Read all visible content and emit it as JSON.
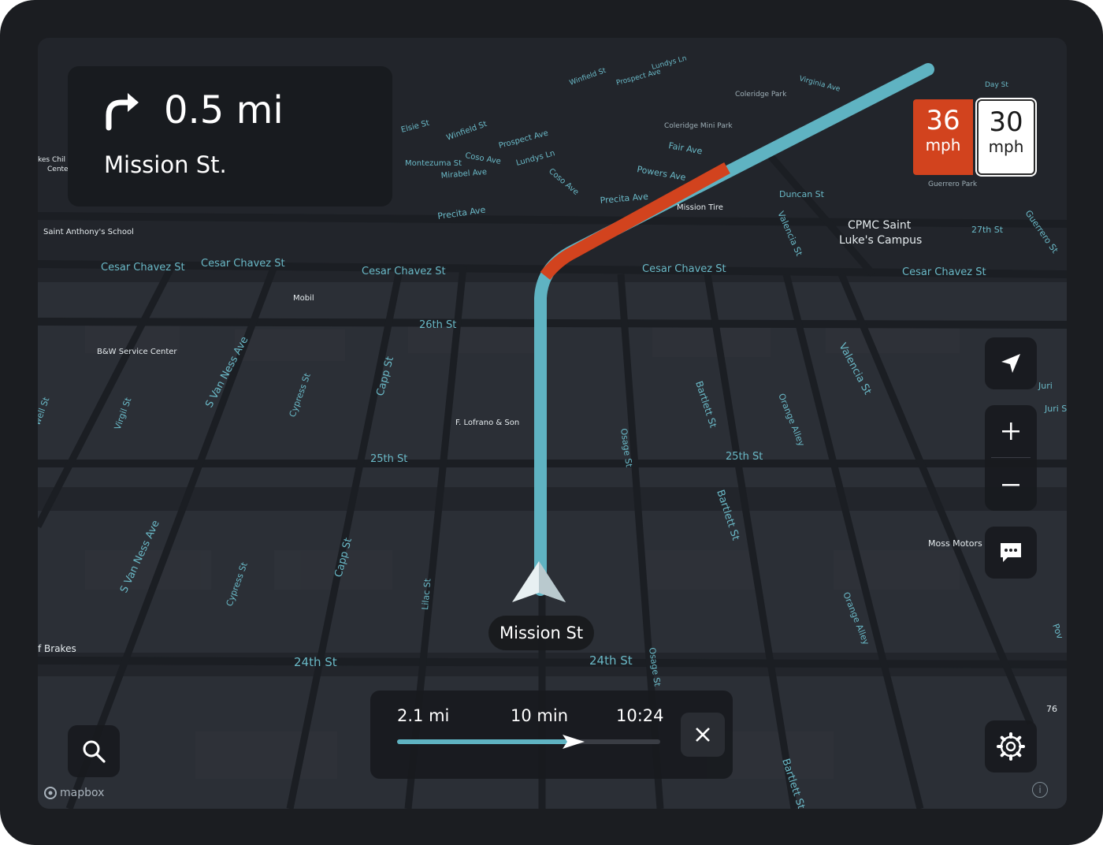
{
  "maneuver": {
    "distance": "0.5 mi",
    "street": "Mission St."
  },
  "speed": {
    "current": "36",
    "current_unit": "mph",
    "limit": "30",
    "limit_unit": "mph"
  },
  "current_road": "Mission St",
  "trip": {
    "remaining_distance": "2.1 mi",
    "remaining_time": "10 min",
    "arrival": "10:24",
    "progress": 0.67
  },
  "brand": "mapbox",
  "info_glyph": "i",
  "colors": {
    "route": "#5fb3c2",
    "traffic_heavy": "#d2431e",
    "panel": "#181a1e",
    "map": "#22252b"
  },
  "map_labels": {
    "streets": [
      "Cesar Chavez St",
      "Cesar Chavez St",
      "Cesar Chavez St",
      "Cesar Chavez St",
      "Cesar Chavez St",
      "26th St",
      "25th St",
      "25th St",
      "24th St",
      "24th St",
      "S Van Ness Ave",
      "S Van Ness Ave",
      "Capp St",
      "Capp St",
      "Cypress St",
      "Cypress St",
      "Virgil St",
      "well St",
      "Lilac St",
      "Osage St",
      "Osage St",
      "Bartlett St",
      "Bartlett St",
      "Bartlett St",
      "Orange Alley",
      "Orange Alley",
      "Valencia St",
      "Valencia St",
      "Guerrero St",
      "27th St",
      "Duncan St",
      "Precita Ave",
      "Precita Ave",
      "Powers Ave",
      "Fair Ave",
      "Coso Ave",
      "Coso Ave",
      "Mirabel Ave",
      "Montezuma St",
      "Lundys Ln",
      "Lundys Ln",
      "Prospect Ave",
      "Prospect Ave",
      "Winfield St",
      "Winfield St",
      "Elsie St",
      "Virginia Ave",
      "Day St",
      "Juri",
      "Juri St",
      "Pov"
    ],
    "pois": [
      "Mission Tire",
      "Mobil",
      "B&W Service Center",
      "F. Lofrano & Son",
      "Saint Anthony's School",
      "CPMC Saint",
      "Luke's Campus",
      "Moss Motors",
      "f Brakes",
      "Coleridge Mini Park",
      "Coleridge Park",
      "Guerrero Park",
      "kes Chil",
      "Cente",
      "76"
    ]
  },
  "icons": {
    "turn": "turn-right-icon",
    "recenter": "location-arrow-icon",
    "zoom_in": "plus-icon",
    "zoom_out": "minus-icon",
    "feedback": "chat-icon",
    "search": "search-icon",
    "settings": "gear-icon",
    "close": "close-icon",
    "puck": "navigation-puck-icon"
  }
}
